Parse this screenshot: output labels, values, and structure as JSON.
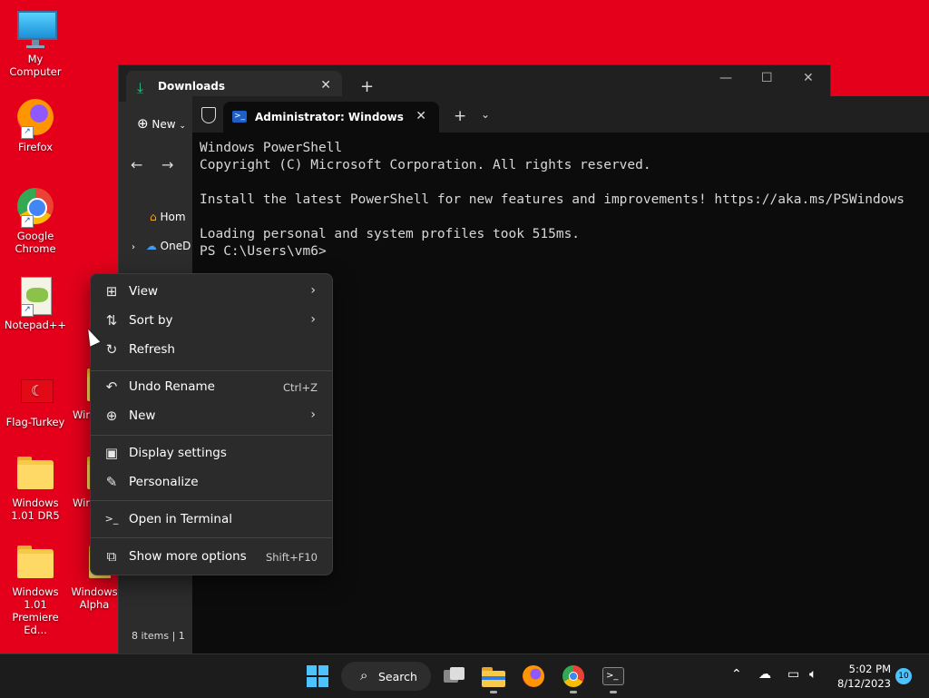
{
  "desktop": {
    "icons": [
      {
        "label": "My Computer"
      },
      {
        "label": "Firefox"
      },
      {
        "label": "Google Chrome"
      },
      {
        "label": "Notepad++"
      },
      {
        "label": "Flag-Turkey"
      },
      {
        "label": "Windows 1.01 DR5"
      },
      {
        "label": "Windows 1.01 Premiere Ed..."
      },
      {
        "label": "Win"
      },
      {
        "label": "Win"
      },
      {
        "label": "Windows Alpha"
      }
    ]
  },
  "explorer": {
    "tab_title": "Downloads",
    "new_label": "New",
    "sidebar": [
      "Hom",
      "OneD"
    ],
    "status": "8 items  |  1"
  },
  "terminal": {
    "tab_title": "Administrator: Windows PowerShell",
    "lines": [
      "Windows PowerShell",
      "Copyright (C) Microsoft Corporation. All rights reserved.",
      "",
      "Install the latest PowerShell for new features and improvements! https://aka.ms/PSWindows",
      "",
      "Loading personal and system profiles took 515ms.",
      "PS C:\\Users\\vm6>"
    ]
  },
  "context_menu": {
    "items": [
      {
        "label": "View",
        "shortcut": "",
        "submenu": true,
        "icon": "grid-icon"
      },
      {
        "label": "Sort by",
        "shortcut": "",
        "submenu": true,
        "icon": "sort-icon"
      },
      {
        "label": "Refresh",
        "shortcut": "",
        "submenu": false,
        "icon": "refresh-icon"
      },
      {
        "label": "Undo Rename",
        "shortcut": "Ctrl+Z",
        "submenu": false,
        "icon": "undo-icon"
      },
      {
        "label": "New",
        "shortcut": "",
        "submenu": true,
        "icon": "plus-circle-icon"
      },
      {
        "label": "Display settings",
        "shortcut": "",
        "submenu": false,
        "icon": "display-icon"
      },
      {
        "label": "Personalize",
        "shortcut": "",
        "submenu": false,
        "icon": "pen-icon"
      },
      {
        "label": "Open in Terminal",
        "shortcut": "",
        "submenu": false,
        "icon": "terminal-icon"
      },
      {
        "label": "Show more options",
        "shortcut": "Shift+F10",
        "submenu": false,
        "icon": "more-options-icon"
      }
    ]
  },
  "taskbar": {
    "search_label": "Search",
    "time": "5:02 PM",
    "date": "8/12/2023",
    "notification_count": "10"
  },
  "colors": {
    "desktop_bg": "#e4001b",
    "accent": "#4cc2ff"
  }
}
